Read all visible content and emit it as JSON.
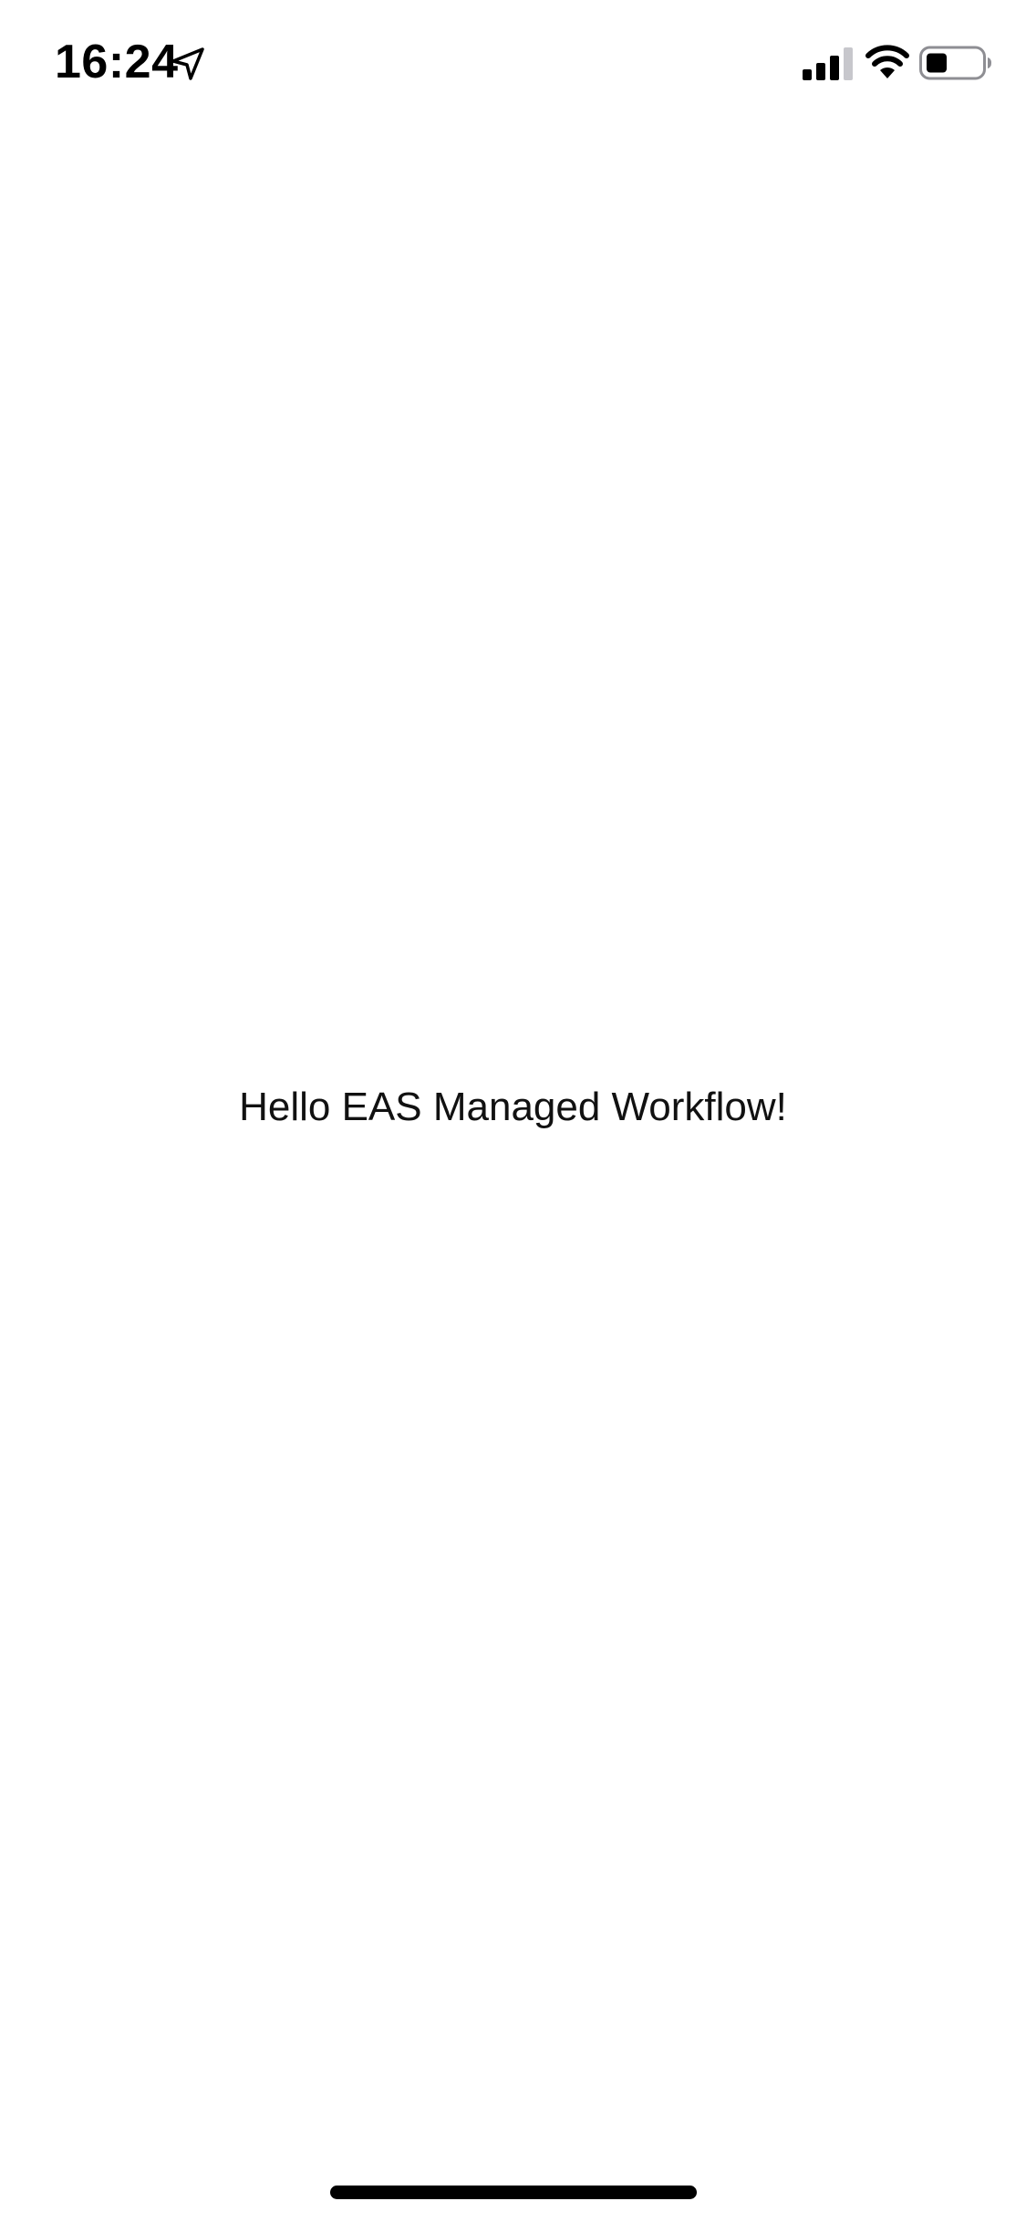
{
  "status_bar": {
    "time": "16:24",
    "icons": {
      "location": "location-arrow-icon",
      "signal": "cellular-signal-icon",
      "wifi": "wifi-icon",
      "battery": "battery-icon"
    }
  },
  "main": {
    "message": "Hello EAS Managed Workflow!"
  },
  "colors": {
    "background": "#ffffff",
    "text": "#111111",
    "signal_inactive": "#c7c7cc"
  }
}
